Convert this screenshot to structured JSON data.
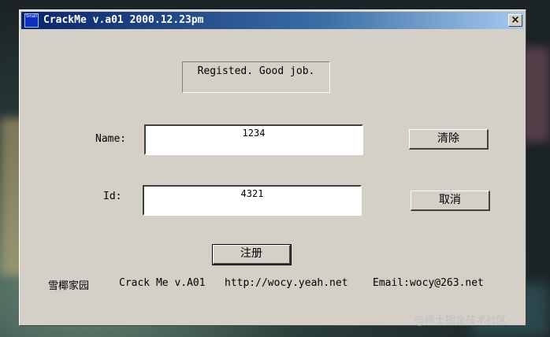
{
  "window": {
    "title": "CrackMe v.a01 2000.12.23pm",
    "close_label": "×",
    "icon_text": "Small"
  },
  "status": {
    "message": "Registed. Good job."
  },
  "form": {
    "name_label": "Name:",
    "name_value": "1234",
    "id_label": "Id:",
    "id_value": "4321"
  },
  "buttons": {
    "clear_label": "清除",
    "cancel_label": "取消",
    "register_label": "注册"
  },
  "footer": {
    "group": "雪椰家园",
    "product": "Crack Me v.A01",
    "url": "http://wocy.yeah.net",
    "email": "Email:wocy@263.net"
  },
  "watermark": "@稀土掘金技术社区"
}
